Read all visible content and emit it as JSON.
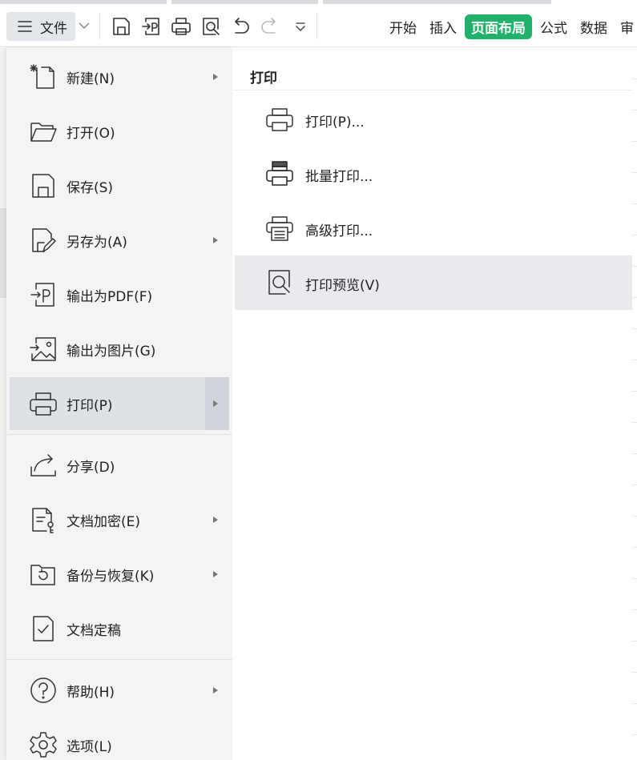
{
  "toolbar": {
    "file_label": "文件",
    "tabs": [
      {
        "label": "开始"
      },
      {
        "label": "插入"
      },
      {
        "label": "页面布局"
      },
      {
        "label": "公式"
      },
      {
        "label": "数据"
      },
      {
        "label": "审"
      }
    ],
    "active_tab": "页面布局",
    "accent_color": "#20b26b"
  },
  "file_menu": {
    "items": [
      {
        "label": "新建(N)",
        "icon": "new-doc-icon",
        "submenu": true
      },
      {
        "label": "打开(O)",
        "icon": "folder-open-icon",
        "submenu": false
      },
      {
        "label": "保存(S)",
        "icon": "save-icon",
        "submenu": false
      },
      {
        "label": "另存为(A)",
        "icon": "save-as-icon",
        "submenu": true
      },
      {
        "label": "输出为PDF(F)",
        "icon": "export-pdf-icon",
        "submenu": false
      },
      {
        "label": "输出为图片(G)",
        "icon": "export-image-icon",
        "submenu": false
      },
      {
        "label": "打印(P)",
        "icon": "printer-icon",
        "submenu": true,
        "active": true
      },
      {
        "label": "分享(D)",
        "icon": "share-icon",
        "submenu": false
      },
      {
        "label": "文档加密(E)",
        "icon": "doc-encrypt-icon",
        "submenu": true
      },
      {
        "label": "备份与恢复(K)",
        "icon": "backup-restore-icon",
        "submenu": true
      },
      {
        "label": "文档定稿",
        "icon": "doc-finalize-icon",
        "submenu": false
      },
      {
        "label": "帮助(H)",
        "icon": "help-icon",
        "submenu": true
      },
      {
        "label": "选项(L)",
        "icon": "gear-icon",
        "submenu": false
      }
    ]
  },
  "print_submenu": {
    "title": "打印",
    "items": [
      {
        "label": "打印(P)...",
        "icon": "printer-icon"
      },
      {
        "label": "批量打印...",
        "icon": "batch-print-icon"
      },
      {
        "label": "高级打印...",
        "icon": "advanced-print-icon"
      },
      {
        "label": "打印预览(V)",
        "icon": "print-preview-icon",
        "hover": true
      }
    ]
  }
}
